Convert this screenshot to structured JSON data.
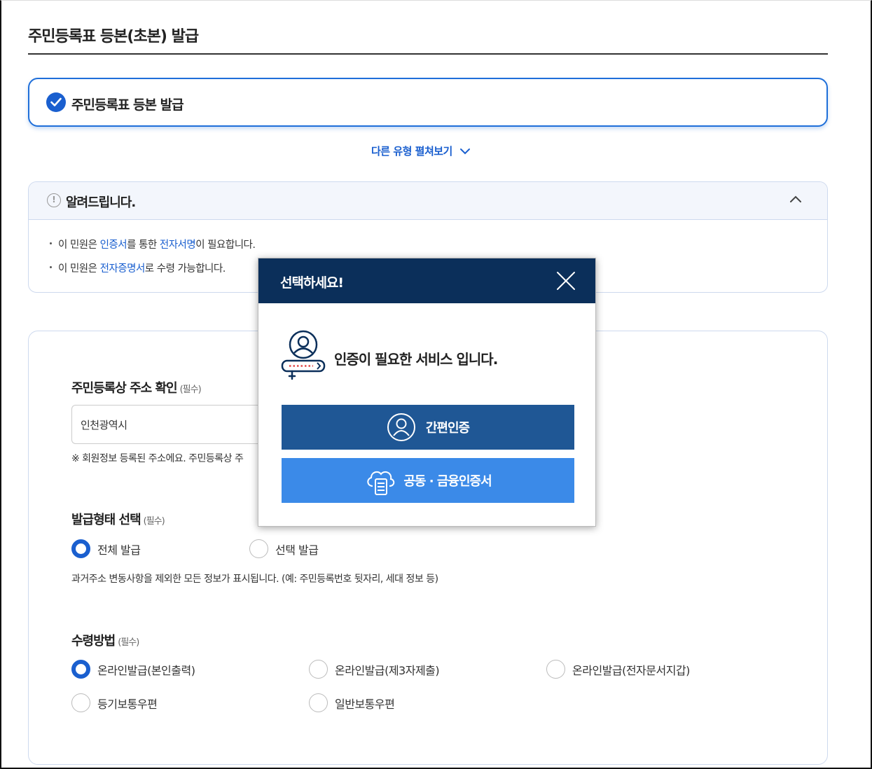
{
  "page": {
    "title": "주민등록표 등본(초본) 발급"
  },
  "selected_type": {
    "label": "주민등록표 등본 발급"
  },
  "other_types": {
    "label": "다른 유형 펼쳐보기"
  },
  "notice": {
    "title": "알려드립니다.",
    "line1_a": "이 민원은 ",
    "line1_b": "인증서",
    "line1_c": "를 통한 ",
    "line1_d": "전자서명",
    "line1_e": "이 필요합니다.",
    "line2_a": "이 민원은 ",
    "line2_b": "전자증명서",
    "line2_c": "로 수령 가능합니다."
  },
  "address": {
    "title": "주민등록상 주소 확인",
    "required": "(필수)",
    "value": "인천광역시",
    "note": "※ 회원정보 등록된 주소에요. 주민등록상 주"
  },
  "issue_type": {
    "title": "발급형태 선택",
    "required": "(필수)",
    "options": [
      "전체 발급",
      "선택 발급"
    ],
    "selected": "전체 발급",
    "description": "과거주소 변동사항을 제외한 모든 정보가 표시됩니다. (예: 주민등록번호 뒷자리, 세대 정보 등)"
  },
  "receive": {
    "title": "수령방법",
    "required": "(필수)",
    "options": [
      "온라인발급(본인출력)",
      "온라인발급(제3자제출)",
      "온라인발급(전자문서지갑)",
      "등기보통우편",
      "일반보통우편"
    ],
    "selected": "온라인발급(본인출력)"
  },
  "modal": {
    "title": "선택하세요!",
    "message": "인증이 필요한 서비스 입니다.",
    "simple_auth": "간편인증",
    "cert_auth": "공동 · 금융인증서"
  },
  "colors": {
    "primary": "#1a5fcf",
    "modal_header": "#0b2f5a",
    "simple_btn": "#1f5795",
    "cert_btn": "#3b8ae8"
  }
}
